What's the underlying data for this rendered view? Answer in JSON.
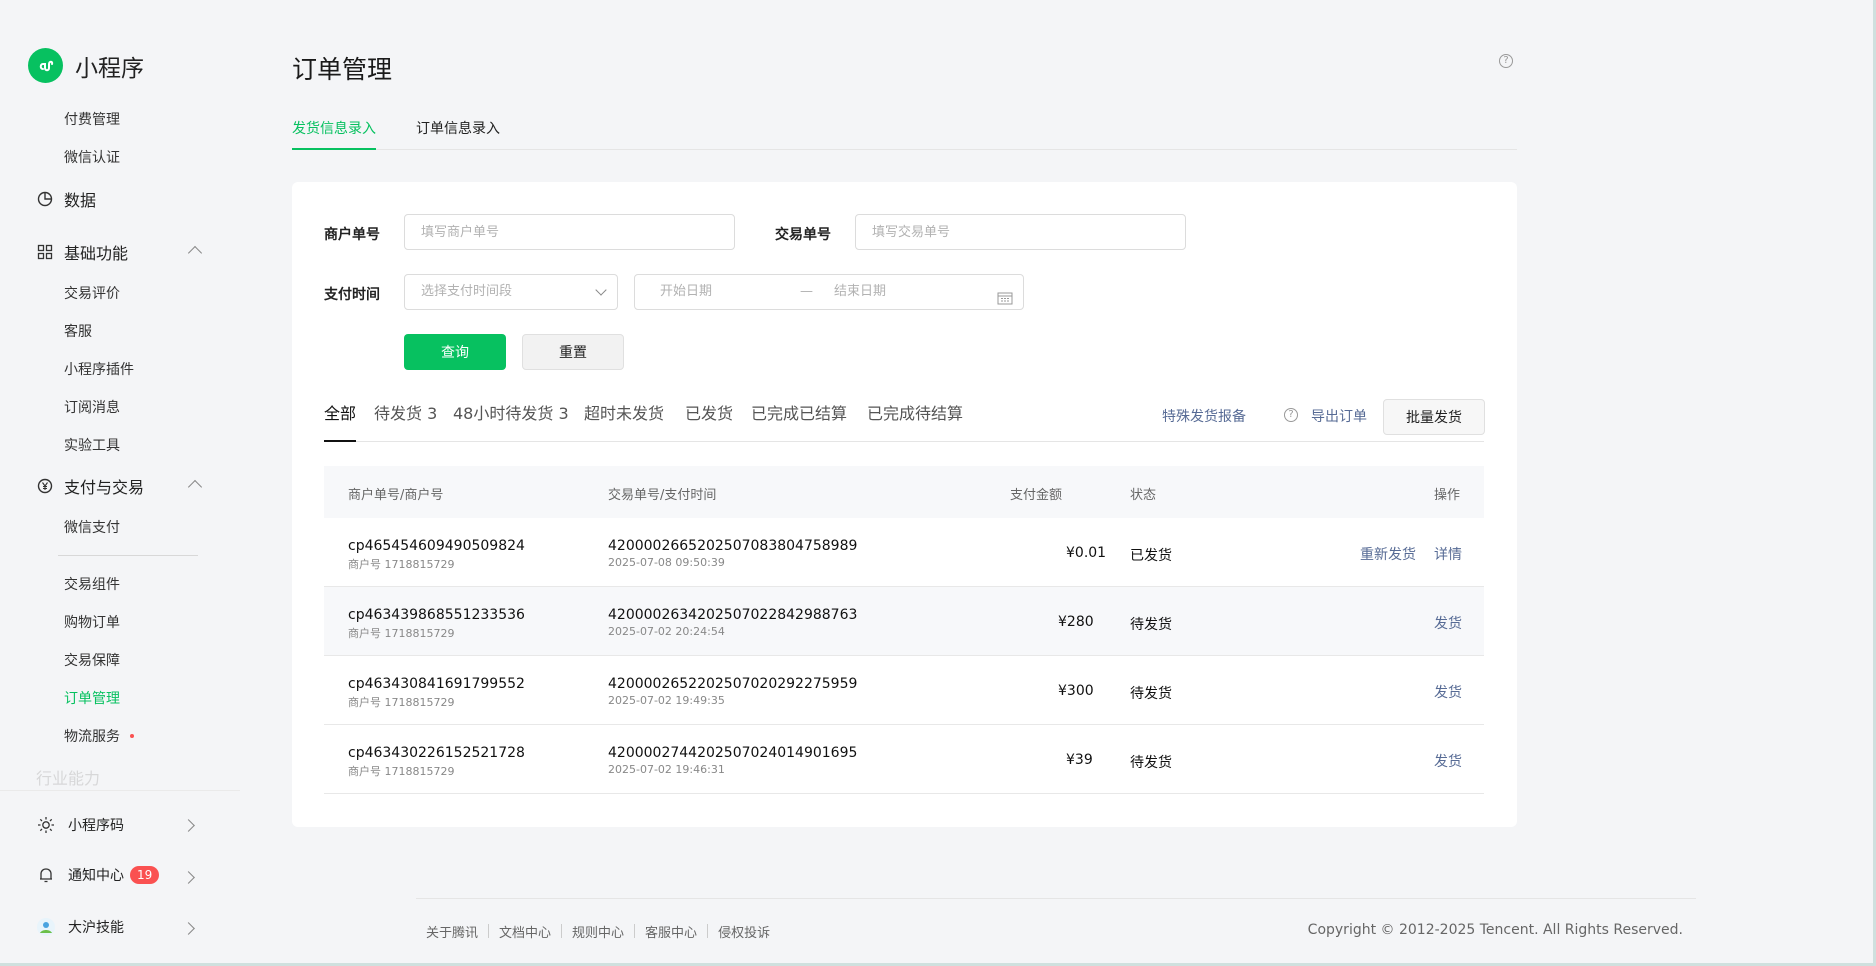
{
  "app": {
    "name": "小程序"
  },
  "sidebar": {
    "pre_items": [
      "付费管理",
      "微信认证"
    ],
    "groups": {
      "data": "数据",
      "basic": "基础功能",
      "basic_items": [
        "交易评价",
        "客服",
        "小程序插件",
        "订阅消息",
        "实验工具"
      ],
      "pay": "支付与交易",
      "pay_items": [
        "微信支付"
      ],
      "trade_items": [
        "交易组件",
        "购物订单",
        "交易保障",
        "订单管理",
        "物流服务"
      ],
      "faded": "行业能力"
    },
    "bottom": {
      "qrcode": "小程序码",
      "notify": "通知中心",
      "notify_count": "19",
      "account": "大沪技能"
    }
  },
  "page": {
    "title": "订单管理",
    "help": "?",
    "tabs": [
      "发货信息录入",
      "订单信息录入"
    ]
  },
  "filters": {
    "merchant_label": "商户单号",
    "merchant_placeholder": "填写商户单号",
    "trade_label": "交易单号",
    "trade_placeholder": "填写交易单号",
    "paytime_label": "支付时间",
    "paytime_select": "选择支付时间段",
    "start_date": "开始日期",
    "date_sep": "—",
    "end_date": "结束日期",
    "query": "查询",
    "reset": "重置"
  },
  "status_tabs": [
    "全部",
    "待发货 3",
    "48小时待发货 3",
    "超时未发货",
    "已发货",
    "已完成已结算",
    "已完成待结算"
  ],
  "actions": {
    "special": "特殊发货报备",
    "export": "导出订单",
    "batch": "批量发货"
  },
  "table": {
    "headers": [
      "商户单号/商户号",
      "交易单号/支付时间",
      "支付金额",
      "状态",
      "操作"
    ],
    "rows": [
      {
        "merchant_no": "cp465454609490509824",
        "merchant_id": "商户号 1718815729",
        "trade_no": "4200002665202507083804758989",
        "pay_time": "2025-07-08 09:50:39",
        "amount": "¥0.01",
        "status": "已发货",
        "ops": [
          "重新发货",
          "详情"
        ]
      },
      {
        "merchant_no": "cp463439868551233536",
        "merchant_id": "商户号 1718815729",
        "trade_no": "4200002634202507022842988763",
        "pay_time": "2025-07-02 20:24:54",
        "amount": "¥280",
        "status": "待发货",
        "ops": [
          "发货"
        ]
      },
      {
        "merchant_no": "cp463430841691799552",
        "merchant_id": "商户号 1718815729",
        "trade_no": "4200002652202507020292275959",
        "pay_time": "2025-07-02 19:49:35",
        "amount": "¥300",
        "status": "待发货",
        "ops": [
          "发货"
        ]
      },
      {
        "merchant_no": "cp463430226152521728",
        "merchant_id": "商户号 1718815729",
        "trade_no": "4200002744202507024014901695",
        "pay_time": "2025-07-02 19:46:31",
        "amount": "¥39",
        "status": "待发货",
        "ops": [
          "发货"
        ]
      }
    ]
  },
  "footer": {
    "links": [
      "关于腾讯",
      "文档中心",
      "规则中心",
      "客服中心",
      "侵权投诉"
    ],
    "copyright": "Copyright © 2012-2025 Tencent. All Rights Reserved."
  },
  "colors": {
    "brand": "#07c160",
    "link": "#576b95",
    "badge": "#fa5151"
  }
}
